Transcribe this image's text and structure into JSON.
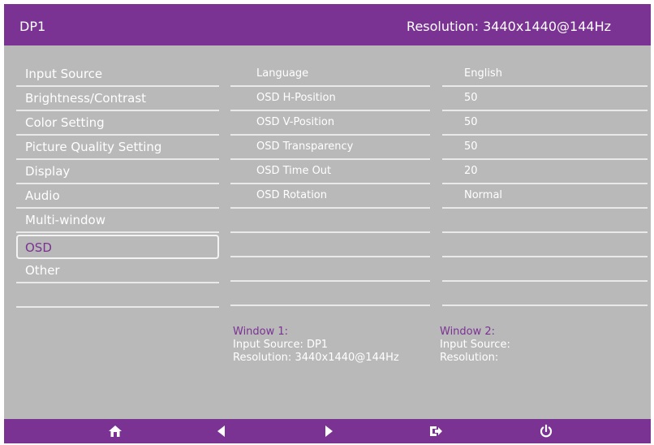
{
  "header": {
    "title": "DP1",
    "resolution": "Resolution: 3440x1440@144Hz"
  },
  "menu": {
    "items": [
      {
        "label": "Input Source"
      },
      {
        "label": "Brightness/Contrast"
      },
      {
        "label": "Color Setting"
      },
      {
        "label": "Picture Quality Setting"
      },
      {
        "label": "Display"
      },
      {
        "label": "Audio"
      },
      {
        "label": "Multi-window"
      },
      {
        "label": "OSD",
        "selected": true
      },
      {
        "label": "Other"
      }
    ]
  },
  "osd_settings": [
    {
      "label": "Language",
      "value": "English"
    },
    {
      "label": "OSD H-Position",
      "value": "50"
    },
    {
      "label": "OSD V-Position",
      "value": "50"
    },
    {
      "label": "OSD Transparency",
      "value": "50"
    },
    {
      "label": "OSD Time Out",
      "value": "20"
    },
    {
      "label": "OSD Rotation",
      "value": "Normal"
    }
  ],
  "window1": {
    "title": "Window 1:",
    "input_source": "Input Source: DP1",
    "resolution": "Resolution: 3440x1440@144Hz"
  },
  "window2": {
    "title": "Window 2:",
    "input_source": "Input Source:",
    "resolution": "Resolution:"
  },
  "footer": {
    "icons": [
      "home-icon",
      "left-arrow-icon",
      "right-arrow-icon",
      "enter-icon",
      "power-icon"
    ]
  },
  "colors": {
    "accent": "#7b3393",
    "panel": "#b9b9b9",
    "text": "#ffffff"
  }
}
